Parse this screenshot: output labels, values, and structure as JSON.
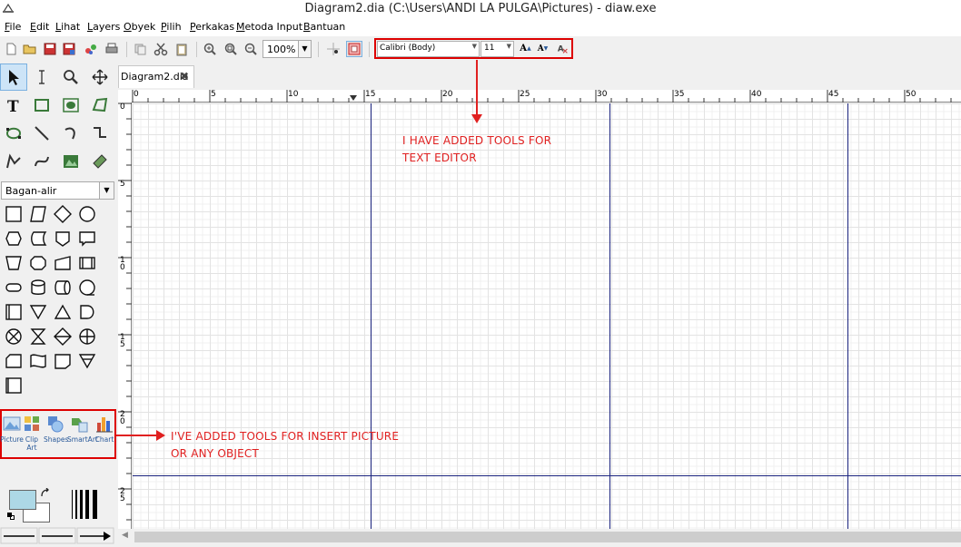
{
  "window": {
    "title": "Diagram2.dia (C:\\Users\\ANDI LA PULGA\\Pictures) - diaw.exe"
  },
  "menu": [
    "File",
    "Edit",
    "Lihat",
    "Layers",
    "Obyek",
    "Pilih",
    "Perkakas",
    "Metoda Input",
    "Bantuan"
  ],
  "toolbar": {
    "zoom_value": "100%",
    "font_family": "Calibri (Body)",
    "font_size": "11"
  },
  "sheet_selector": {
    "value": "Bagan-alir"
  },
  "insert_tools": [
    {
      "label": "Picture",
      "icon": "picture-icon"
    },
    {
      "label": "Clip Art",
      "icon": "clip-art-icon"
    },
    {
      "label": "Shapes",
      "icon": "shapes-icon"
    },
    {
      "label": "SmartArt",
      "icon": "smartart-icon"
    },
    {
      "label": "Chart",
      "icon": "chart-icon"
    }
  ],
  "tab": {
    "label": "Diagram2.dia"
  },
  "ruler": {
    "h_labels": [
      "0",
      "5",
      "10",
      "15",
      "20",
      "25",
      "30",
      "35",
      "40",
      "45",
      "50"
    ],
    "v_labels": [
      "0",
      "5",
      "10",
      "15",
      "20",
      "25"
    ]
  },
  "annotations": {
    "text_editor_line1": "I HAVE ADDED TOOLS FOR",
    "text_editor_line2": "TEXT EDITOR",
    "insert_line1": "I'VE ADDED TOOLS FOR INSERT PICTURE",
    "insert_line2": "OR ANY OBJECT"
  },
  "colors": {
    "annotation": "#e02020",
    "page_break": "#1a237e",
    "fg_color": "#add8e6"
  }
}
